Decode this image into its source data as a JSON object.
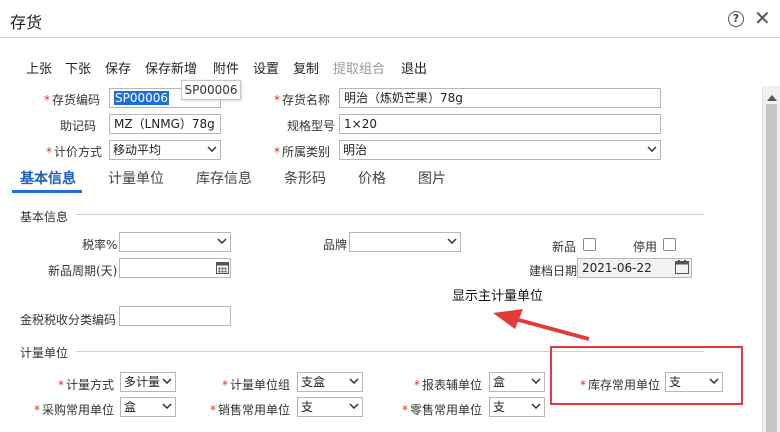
{
  "window": {
    "title": "存货"
  },
  "toolbar": {
    "prev": "上张",
    "next": "下张",
    "save": "保存",
    "save_new": "保存新增",
    "attach": "附件",
    "settings": "设置",
    "copy": "复制",
    "extract": "提取组合",
    "exit": "退出"
  },
  "tooltip": "SP00006",
  "header_form": {
    "code_label": "存货编码",
    "code_value": "SP00006",
    "name_label": "存货名称",
    "name_value": "明治（炼奶芒果）78g",
    "mnemonic_label": "助记码",
    "mnemonic_value": "MZ（LNMG）78g",
    "spec_label": "规格型号",
    "spec_value": "1×20",
    "pricing_label": "计价方式",
    "pricing_value": "移动平均",
    "category_label": "所属类别",
    "category_value": "明治"
  },
  "tabs": [
    "基本信息",
    "计量单位",
    "库存信息",
    "条形码",
    "价格",
    "图片"
  ],
  "basic_info": {
    "section_title": "基本信息",
    "tax_rate_label": "税率%",
    "tax_rate_value": "",
    "brand_label": "品牌",
    "brand_value": "",
    "new_product_label": "新品",
    "disabled_label": "停用",
    "new_period_label": "新品周期(天)",
    "new_period_value": "",
    "created_date_label": "建档日期",
    "created_date_value": "2021-06-22",
    "tax_code_label": "金税税收分类编码",
    "tax_code_value": ""
  },
  "annotation": "显示主计量单位",
  "unit_section": {
    "section_title": "计量单位",
    "measure_label": "计量方式",
    "measure_value": "多计量",
    "unit_group_label": "计量单位组",
    "unit_group_value": "支盒",
    "report_unit_label": "报表辅单位",
    "report_unit_value": "盒",
    "stock_unit_label": "库存常用单位",
    "stock_unit_value": "支",
    "purchase_unit_label": "采购常用单位",
    "purchase_unit_value": "盒",
    "sales_unit_label": "销售常用单位",
    "sales_unit_value": "支",
    "retail_unit_label": "零售常用单位",
    "retail_unit_value": "支"
  },
  "colors": {
    "accent": "#1e6fd6",
    "required": "#e0301e",
    "annotation_red": "#e33a3a"
  }
}
